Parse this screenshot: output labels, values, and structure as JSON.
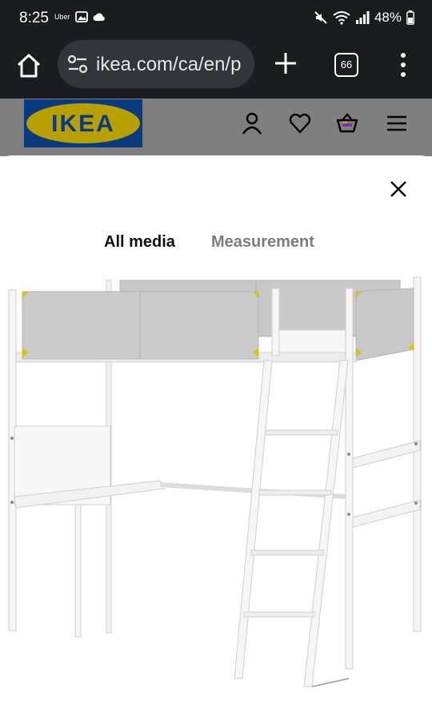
{
  "status_bar": {
    "time": "8:25",
    "uber": "Uber",
    "battery": "48%"
  },
  "browser": {
    "url": "ikea.com/ca/en/p",
    "tab_count": "66"
  },
  "ikea": {
    "logo_text": "IKEA",
    "colors": {
      "blue": "#0058A3",
      "yellow": "#FFDB00"
    }
  },
  "modal": {
    "tabs": [
      {
        "label": "All media"
      },
      {
        "label": "Measurement"
      }
    ]
  }
}
